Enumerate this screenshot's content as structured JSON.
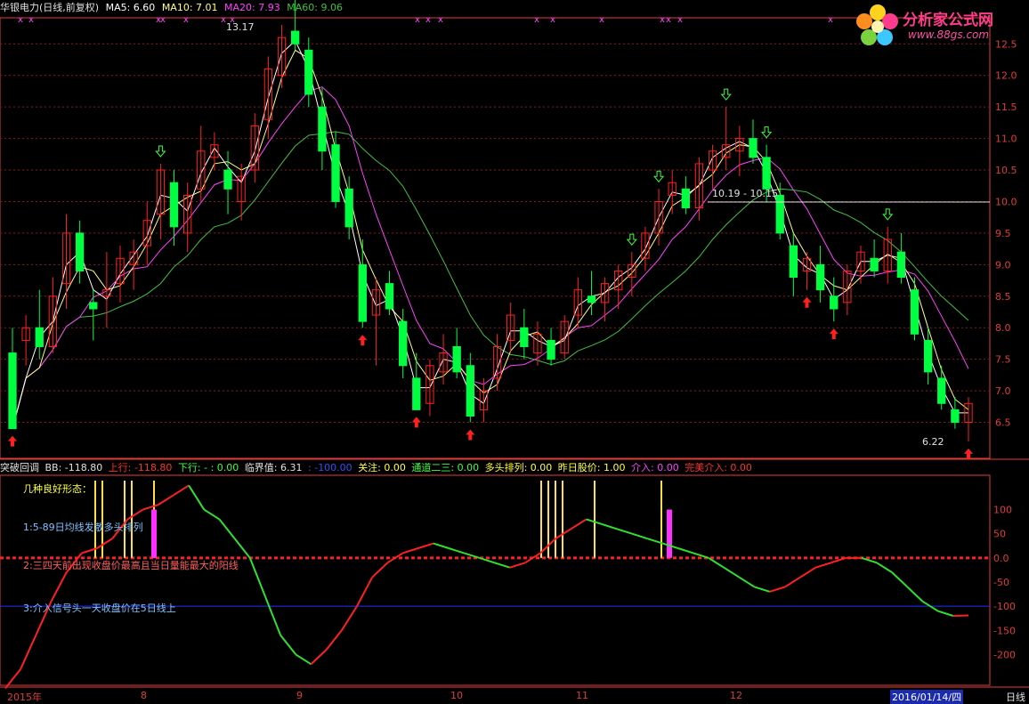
{
  "header": {
    "title": "华银电力(日线,前复权)",
    "ma5": "MA5: 6.60",
    "ma10": "MA10: 7.01",
    "ma20": "MA20: 7.93",
    "ma60": "MA60: 9.06"
  },
  "indicator_bar": {
    "name": "突破回调",
    "bb": "BB: -118.80",
    "up": "上行: -118.80",
    "down": "下行: - : 0.00",
    "crit": "临界值: 6.31",
    "neg100": ": -100.00",
    "watch": "关注: 0.00",
    "channel": "通道二三: 0.00",
    "bull": "多头排列: 0.00",
    "prev": "昨日股价: 1.00",
    "enter": "介入: 0.00",
    "perfect": "完美介入: 0.00"
  },
  "annotations": {
    "line0": "几种良好形态：",
    "line1": "1:5-89日均线发散多头排列",
    "line2": "2:三四天前出现收盘价最高且当日量能最大的阳线",
    "line3": "3:介入信号头一天收盘价在5日线上",
    "high_label": "13.17",
    "low_label": "6.22",
    "range_label": "10.19 - 10.15"
  },
  "logo": {
    "name": "分析家公式网",
    "url": "www.88gs.com"
  },
  "x_axis": {
    "labels": [
      "2015年",
      "8",
      "9",
      "10",
      "11",
      "12"
    ],
    "date_box": "2016/01/14/四",
    "period": "日线"
  },
  "colors": {
    "up_candle": "#ff2020",
    "down_candle": "#00ff40",
    "ma5": "#ffffff",
    "ma10": "#ffff80",
    "ma20": "#ff40ff",
    "ma60": "#40c040",
    "grid": "#8b1a1a",
    "axis": "#e23b3b"
  },
  "chart_data": [
    {
      "type": "candlestick",
      "title": "华银电力(日线,前复权)",
      "ylim": [
        6.0,
        12.8
      ],
      "y_ticks": [
        6.5,
        7.0,
        7.5,
        8.0,
        8.5,
        9.0,
        9.5,
        10.0,
        10.5,
        11.0,
        11.5,
        12.0,
        12.5
      ],
      "ohlc": [
        [
          7.6,
          8.0,
          6.4,
          6.4
        ],
        [
          7.8,
          8.2,
          7.4,
          8.0
        ],
        [
          8.0,
          8.6,
          7.5,
          7.7
        ],
        [
          7.7,
          8.8,
          7.6,
          8.5
        ],
        [
          8.7,
          9.8,
          8.3,
          9.5
        ],
        [
          9.5,
          9.7,
          8.7,
          8.9
        ],
        [
          8.4,
          8.6,
          7.8,
          8.3
        ],
        [
          8.5,
          9.2,
          8.0,
          8.6
        ],
        [
          8.7,
          9.3,
          8.4,
          9.1
        ],
        [
          9.0,
          9.4,
          8.6,
          9.2
        ],
        [
          9.3,
          10.0,
          9.0,
          9.7
        ],
        [
          9.8,
          10.6,
          9.4,
          10.5
        ],
        [
          10.3,
          10.5,
          9.3,
          9.6
        ],
        [
          9.5,
          10.3,
          9.2,
          10.1
        ],
        [
          10.2,
          11.2,
          10.0,
          10.8
        ],
        [
          10.7,
          11.1,
          10.5,
          10.9
        ],
        [
          10.5,
          10.8,
          9.8,
          10.2
        ],
        [
          10.0,
          10.6,
          9.7,
          10.4
        ],
        [
          10.5,
          11.4,
          10.3,
          11.2
        ],
        [
          11.3,
          12.3,
          11.0,
          12.1
        ],
        [
          12.0,
          12.8,
          11.8,
          12.6
        ],
        [
          12.7,
          13.2,
          12.4,
          12.5
        ],
        [
          12.4,
          12.6,
          11.5,
          11.7
        ],
        [
          11.5,
          11.8,
          10.5,
          10.8
        ],
        [
          10.9,
          11.1,
          9.9,
          10.0
        ],
        [
          10.2,
          10.4,
          9.4,
          9.6
        ],
        [
          9.0,
          9.4,
          8.0,
          8.1
        ],
        [
          8.2,
          8.8,
          7.4,
          8.6
        ],
        [
          8.7,
          8.9,
          8.2,
          8.3
        ],
        [
          8.1,
          8.3,
          7.2,
          7.4
        ],
        [
          7.2,
          7.6,
          6.7,
          6.7
        ],
        [
          6.8,
          7.5,
          6.6,
          7.4
        ],
        [
          7.3,
          7.9,
          7.1,
          7.6
        ],
        [
          7.7,
          8.0,
          7.2,
          7.3
        ],
        [
          7.4,
          7.6,
          6.5,
          6.6
        ],
        [
          6.7,
          7.2,
          6.5,
          7.0
        ],
        [
          7.2,
          7.9,
          7.0,
          7.7
        ],
        [
          7.8,
          8.4,
          7.6,
          8.2
        ],
        [
          8.0,
          8.3,
          7.5,
          7.7
        ],
        [
          7.6,
          8.1,
          7.4,
          7.9
        ],
        [
          7.8,
          8.0,
          7.4,
          7.5
        ],
        [
          7.6,
          8.2,
          7.5,
          8.1
        ],
        [
          8.2,
          8.8,
          8.0,
          8.6
        ],
        [
          8.5,
          8.9,
          8.2,
          8.4
        ],
        [
          8.4,
          8.8,
          8.1,
          8.7
        ],
        [
          8.6,
          9.0,
          8.3,
          8.9
        ],
        [
          8.8,
          9.2,
          8.5,
          9.0
        ],
        [
          9.1,
          9.6,
          8.9,
          9.5
        ],
        [
          9.5,
          10.2,
          9.3,
          10.0
        ],
        [
          10.1,
          10.5,
          9.8,
          10.3
        ],
        [
          10.2,
          10.4,
          9.8,
          9.9
        ],
        [
          9.9,
          10.7,
          9.7,
          10.6
        ],
        [
          10.5,
          10.9,
          10.2,
          10.8
        ],
        [
          10.7,
          11.5,
          10.5,
          10.9
        ],
        [
          10.8,
          11.2,
          10.4,
          11.0
        ],
        [
          11.0,
          11.3,
          10.6,
          10.7
        ],
        [
          10.7,
          10.9,
          10.0,
          10.2
        ],
        [
          10.1,
          10.3,
          9.4,
          9.5
        ],
        [
          9.3,
          9.5,
          8.5,
          8.8
        ],
        [
          8.9,
          9.2,
          8.6,
          9.1
        ],
        [
          9.0,
          9.3,
          8.4,
          8.6
        ],
        [
          8.5,
          8.8,
          8.1,
          8.3
        ],
        [
          8.4,
          9.0,
          8.2,
          8.9
        ],
        [
          8.9,
          9.3,
          8.7,
          9.2
        ],
        [
          9.1,
          9.4,
          8.8,
          8.9
        ],
        [
          8.9,
          9.6,
          8.7,
          9.4
        ],
        [
          9.2,
          9.5,
          8.7,
          8.8
        ],
        [
          8.6,
          8.8,
          7.8,
          7.9
        ],
        [
          7.8,
          8.0,
          7.1,
          7.3
        ],
        [
          7.2,
          7.4,
          6.7,
          6.8
        ],
        [
          6.7,
          6.9,
          6.4,
          6.5
        ],
        [
          6.5,
          6.9,
          6.2,
          6.8
        ]
      ],
      "series": [
        {
          "name": "MA5",
          "value_last": 6.6
        },
        {
          "name": "MA10",
          "value_last": 7.01
        },
        {
          "name": "MA20",
          "value_last": 7.93
        },
        {
          "name": "MA60",
          "value_last": 9.06
        }
      ],
      "annotations": {
        "max": 13.17,
        "min": 6.22
      }
    },
    {
      "type": "line",
      "title": "突破回调",
      "ylim": [
        -260,
        160
      ],
      "y_ticks": [
        100,
        50,
        0.0,
        -50,
        -100,
        -150,
        -200
      ],
      "series": [
        {
          "name": "BB",
          "values": [
            -270,
            -230,
            -160,
            -90,
            -30,
            10,
            20,
            40,
            80,
            100,
            110,
            130,
            150,
            100,
            80,
            40,
            0,
            -80,
            -160,
            -200,
            -220,
            -190,
            -150,
            -100,
            -40,
            -10,
            10,
            20,
            30,
            20,
            10,
            0,
            -10,
            -20,
            -10,
            10,
            40,
            60,
            80,
            70,
            60,
            50,
            40,
            30,
            20,
            10,
            0,
            -20,
            -40,
            -60,
            -70,
            -60,
            -40,
            -20,
            -10,
            0,
            0,
            -10,
            -30,
            -60,
            -90,
            -110,
            -120,
            -119
          ]
        }
      ],
      "reference_lines": [
        0,
        -100
      ]
    }
  ]
}
